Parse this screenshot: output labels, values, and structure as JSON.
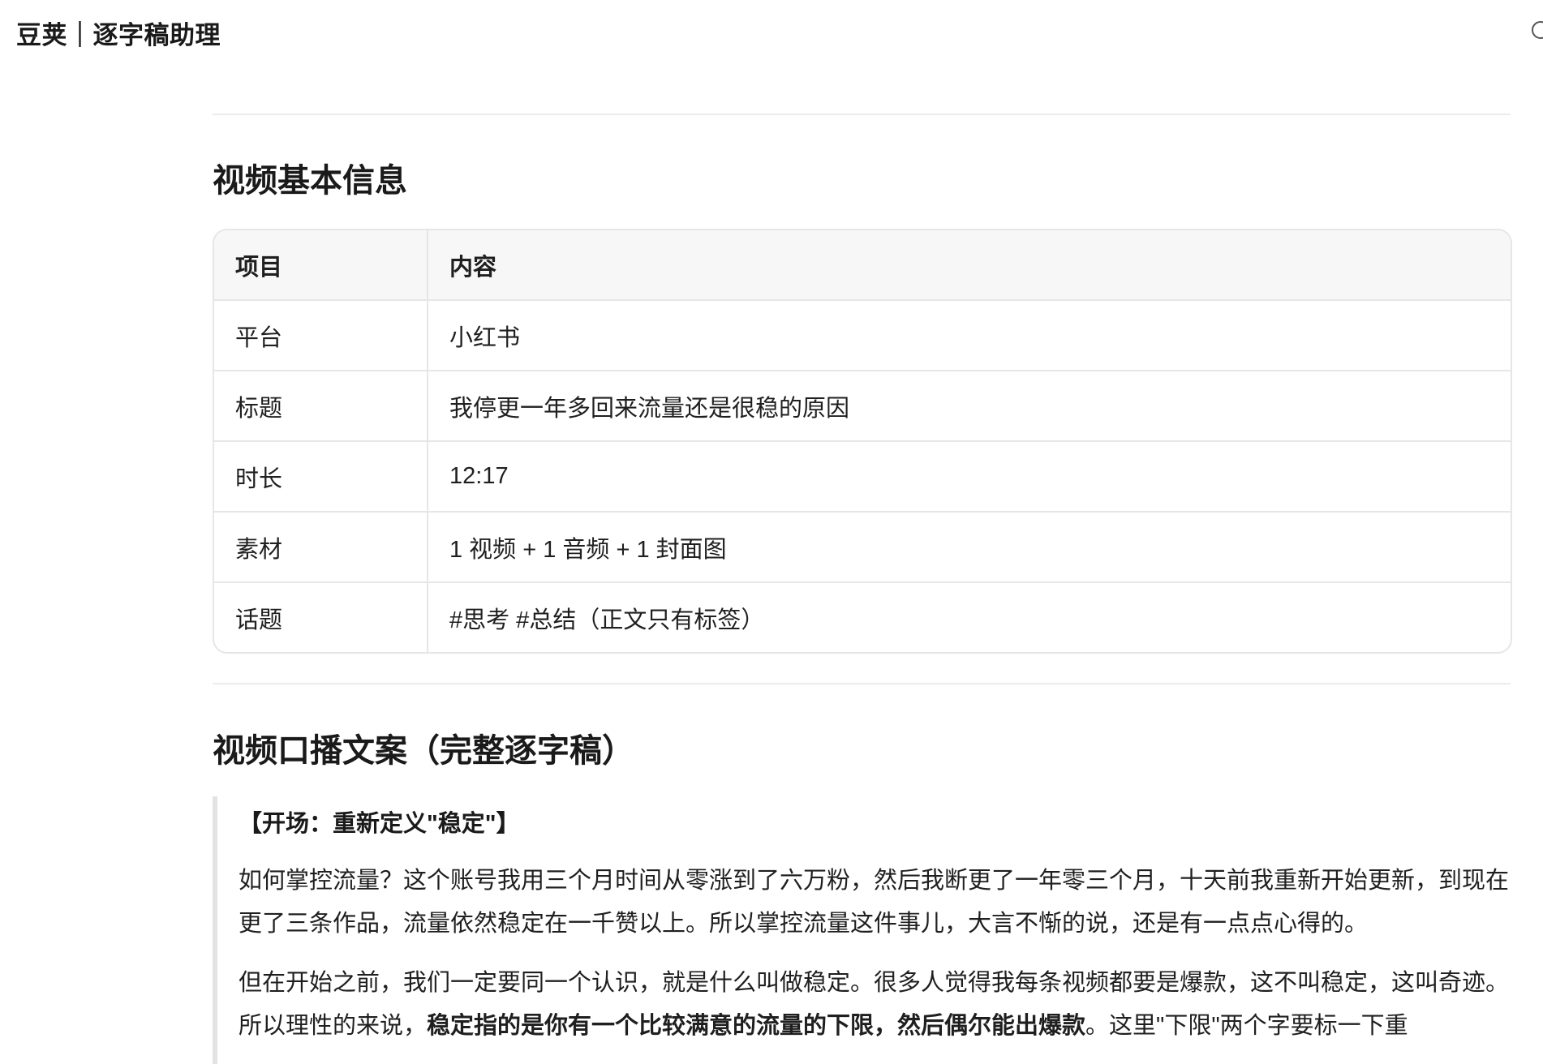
{
  "app": {
    "title": "豆荚｜逐字稿助理"
  },
  "icons": {
    "search": "search-icon"
  },
  "section1": {
    "title": "视频基本信息",
    "table": {
      "headers": [
        "项目",
        "内容"
      ],
      "rows": [
        [
          "平台",
          "小红书"
        ],
        [
          "标题",
          "我停更一年多回来流量还是很稳的原因"
        ],
        [
          "时长",
          "12:17"
        ],
        [
          "素材",
          "1 视频 + 1 音频 + 1 封面图"
        ],
        [
          "话题",
          "#思考 #总结（正文只有标签）"
        ]
      ]
    }
  },
  "section2": {
    "title": "视频口播文案（完整逐字稿）",
    "quote_heading": "【开场：重新定义\"稳定\"】",
    "para1": "如何掌控流量？这个账号我用三个月时间从零涨到了六万粉，然后我断更了一年零三个月，十天前我重新开始更新，到现在更了三条作品，流量依然稳定在一千赞以上。所以掌控流量这件事儿，大言不惭的说，还是有一点点心得的。",
    "para2_a": "但在开始之前，我们一定要同一个认识，就是什么叫做稳定。很多人觉得我每条视频都要是爆款，这不叫稳定，这叫奇迹。所以理性的来说，",
    "para2_bold": "稳定指的是你有一个比较满意的流量的下限，然后偶尔能出爆款",
    "para2_c": "。这里\"下限\"两个字要标一下重"
  }
}
